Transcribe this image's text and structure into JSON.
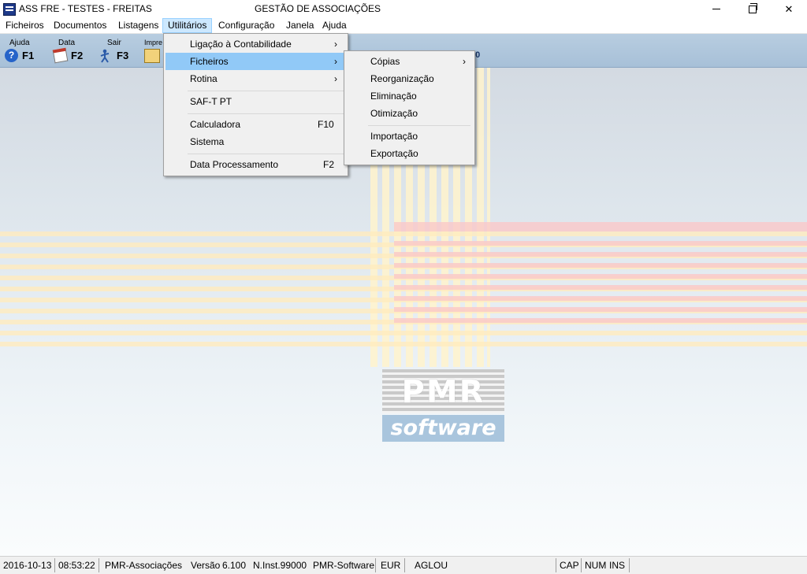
{
  "window": {
    "title": "ASS FRE - TESTES - FREITAS",
    "center_title": "GESTÃO DE ASSOCIAÇÕES"
  },
  "menubar": {
    "items": [
      "Ficheiros",
      "Documentos",
      "Listagens",
      "Utilitários",
      "Configuração",
      "Janela",
      "Ajuda"
    ],
    "active": "Utilitários"
  },
  "toolbar": {
    "help": {
      "label": "Ajuda",
      "key": "F1"
    },
    "date": {
      "label": "Data",
      "key": "F2"
    },
    "exit": {
      "label": "Sair",
      "key": "F3"
    },
    "print": {
      "label": "Impre"
    },
    "right_fragment": "00"
  },
  "utilitarios_menu": {
    "items": [
      {
        "label": "Ligação à Contabilidade",
        "submenu": true
      },
      {
        "label": "Ficheiros",
        "submenu": true,
        "highlighted": true
      },
      {
        "label": "Rotina",
        "submenu": true
      },
      {
        "label": "SAF-T PT"
      },
      {
        "label": "Calculadora",
        "shortcut": "F10"
      },
      {
        "label": "Sistema"
      },
      {
        "label": "Data Processamento",
        "shortcut": "F2"
      }
    ],
    "arrow": "›"
  },
  "ficheiros_submenu": {
    "items": [
      {
        "label": "Cópias",
        "submenu": true
      },
      {
        "label": "Reorganização"
      },
      {
        "label": "Eliminação"
      },
      {
        "label": "Otimização"
      },
      {
        "label": "Importação"
      },
      {
        "label": "Exportação"
      }
    ]
  },
  "logo": {
    "top": "PMR",
    "bottom": "software"
  },
  "statusbar": {
    "date": "2016-10-13",
    "time": "08:53:22",
    "app": "PMR-Associações",
    "version_label": "Versão",
    "version": "6.100",
    "instance": "N.Inst.99000",
    "vendor": "PMR-Software",
    "currency": "EUR",
    "user": "AGLOU",
    "cap": "CAP",
    "num": "NUM",
    "ins": "INS"
  },
  "colors": {
    "menu_highlight": "#91c9f7",
    "active_menu": "#cce8ff",
    "toolbar": "#b8cde0"
  }
}
